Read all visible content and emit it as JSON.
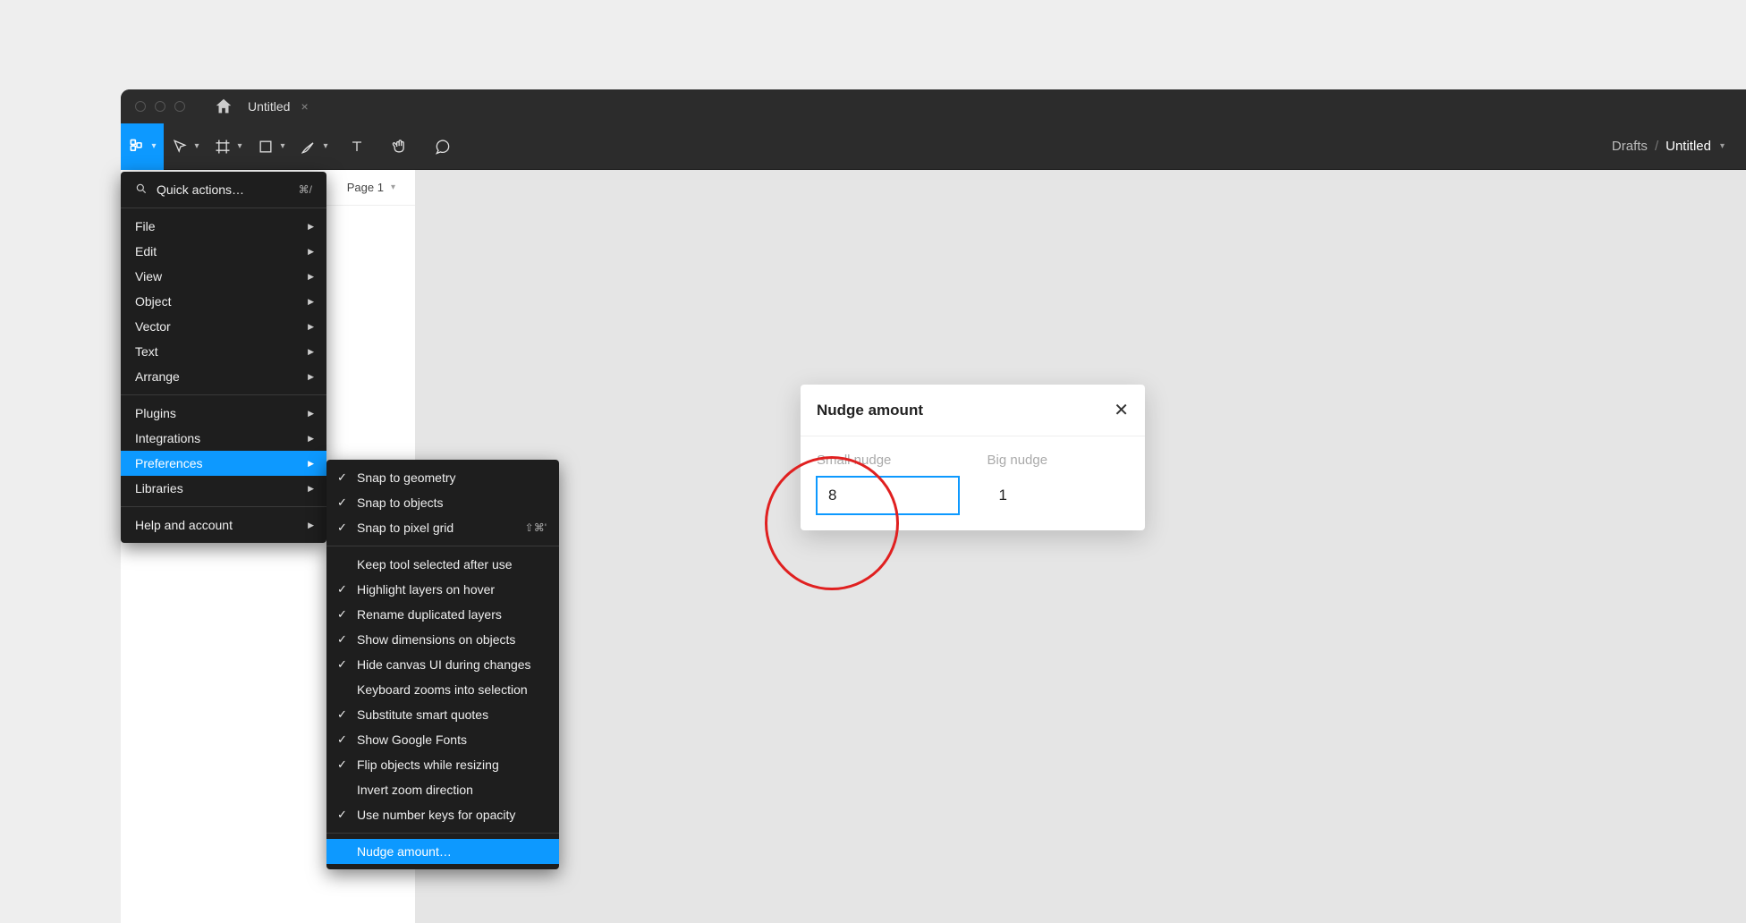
{
  "titlebar": {
    "tab_name": "Untitled"
  },
  "toolbar_right": {
    "location": "Drafts",
    "separator": "/",
    "file_name": "Untitled"
  },
  "left_panel": {
    "page_label": "Page 1"
  },
  "main_menu": {
    "quick_actions": "Quick actions…",
    "quick_shortcut": "⌘/",
    "items_group1": [
      "File",
      "Edit",
      "View",
      "Object",
      "Vector",
      "Text",
      "Arrange"
    ],
    "items_group2": [
      "Plugins",
      "Integrations",
      "Preferences",
      "Libraries"
    ],
    "items_group3": [
      "Help and account"
    ],
    "highlighted": "Preferences"
  },
  "submenu": {
    "group1": [
      {
        "label": "Snap to geometry",
        "checked": true
      },
      {
        "label": "Snap to objects",
        "checked": true
      },
      {
        "label": "Snap to pixel grid",
        "checked": true,
        "shortcut": "⇧⌘'"
      }
    ],
    "group2": [
      {
        "label": "Keep tool selected after use",
        "checked": false
      },
      {
        "label": "Highlight layers on hover",
        "checked": true
      },
      {
        "label": "Rename duplicated layers",
        "checked": true
      },
      {
        "label": "Show dimensions on objects",
        "checked": true
      },
      {
        "label": "Hide canvas UI during changes",
        "checked": true
      },
      {
        "label": "Keyboard zooms into selection",
        "checked": false
      },
      {
        "label": "Substitute smart quotes",
        "checked": true
      },
      {
        "label": "Show Google Fonts",
        "checked": true
      },
      {
        "label": "Flip objects while resizing",
        "checked": true
      },
      {
        "label": "Invert zoom direction",
        "checked": false
      },
      {
        "label": "Use number keys for opacity",
        "checked": true
      }
    ],
    "group3": [
      {
        "label": "Nudge amount…",
        "checked": false,
        "highlight": true
      }
    ]
  },
  "modal": {
    "title": "Nudge amount",
    "small_label": "Small nudge",
    "big_label": "Big nudge",
    "small_value": "8",
    "big_value": "1"
  }
}
